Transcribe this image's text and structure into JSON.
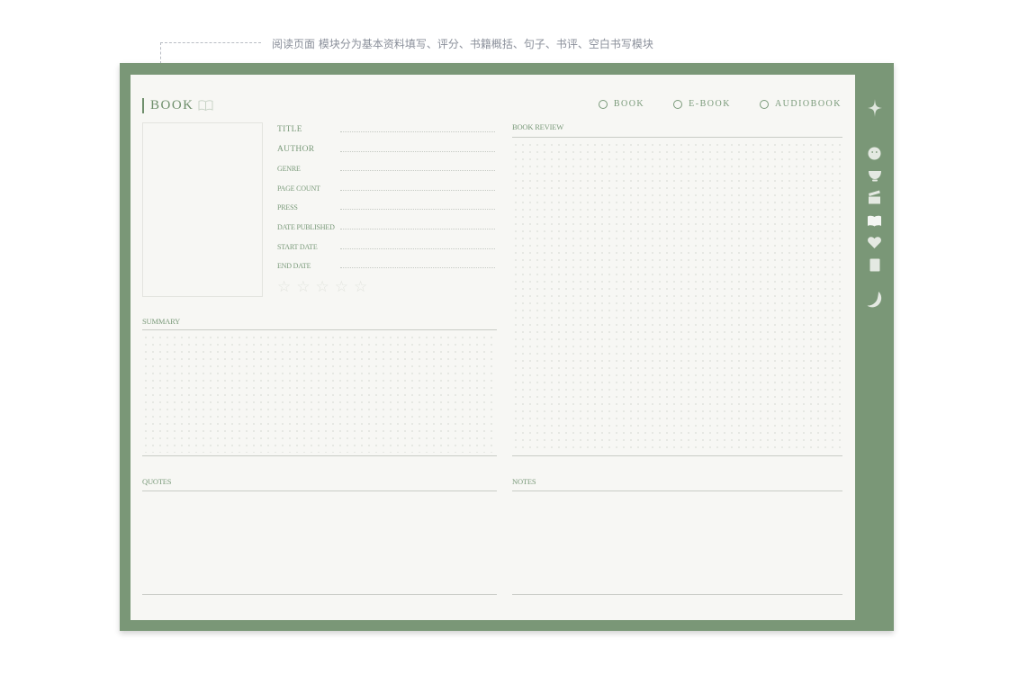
{
  "annotation": {
    "text": "阅读页面 模块分为基本资料填写、评分、书籍概括、句子、书评、空白书写模块"
  },
  "header": {
    "title": "BOOK",
    "formats": [
      {
        "label": "BOOK"
      },
      {
        "label": "E-BOOK"
      },
      {
        "label": "AUDIOBOOK"
      }
    ]
  },
  "fields": [
    {
      "label": "TITLE"
    },
    {
      "label": "AUTHOR"
    },
    {
      "label": "GENRE"
    },
    {
      "label": "PAGE COUNT"
    },
    {
      "label": "PRESS"
    },
    {
      "label": "DATE PUBLISHED"
    },
    {
      "label": "START DATE"
    },
    {
      "label": "END DATE"
    }
  ],
  "rating": {
    "max": 5,
    "value": 0
  },
  "sections": {
    "summary": "SUMMARY",
    "book_review": "BOOK REVIEW",
    "quotes": "QUOTES",
    "notes": "NOTES"
  },
  "sidebar": {
    "icons": [
      "sparkle-icon",
      "emoji-icon",
      "bowl-icon",
      "clapperboard-icon",
      "book-icon",
      "heart-icon",
      "notebook-icon",
      "moon-icon"
    ]
  },
  "colors": {
    "frame": "#7a9777",
    "sheet": "#f7f7f4",
    "accent": "#6f8f6c"
  }
}
